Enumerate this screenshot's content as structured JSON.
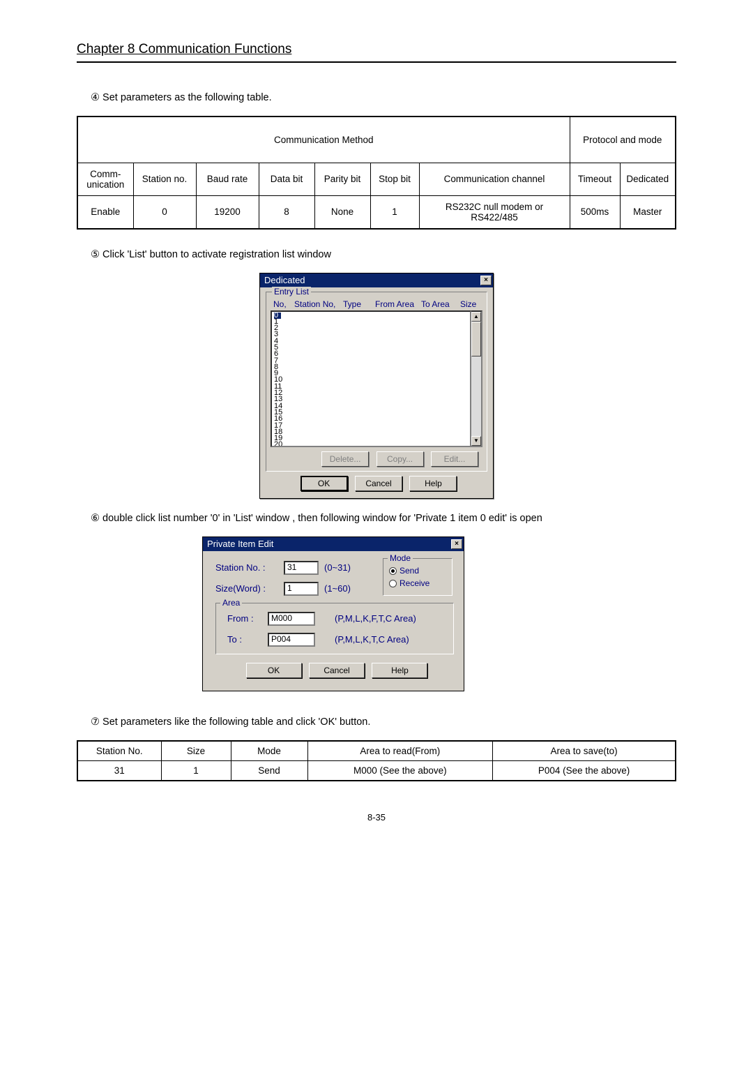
{
  "header": {
    "chapter": "Chapter 8   Communication Functions"
  },
  "step4": {
    "num": "④",
    "text": "Set parameters as the following table."
  },
  "table1": {
    "h_comm_method": "Communication Method",
    "h_protocol": "Protocol and mode",
    "cols": [
      "Comm-unication",
      "Station no.",
      "Baud rate",
      "Data bit",
      "Parity bit",
      "Stop bit",
      "Communication channel",
      "Timeout",
      "Dedicated"
    ],
    "row": [
      "Enable",
      "0",
      "19200",
      "8",
      "None",
      "1",
      "RS232C null modem or RS422/485",
      "500ms",
      "Master"
    ]
  },
  "step5": {
    "num": "⑤",
    "text": "Click 'List' button to activate registration list window"
  },
  "dedicated": {
    "title": "Dedicated",
    "group": "Entry List",
    "hdr": [
      "No,",
      "Station No,",
      "Type",
      "From Area",
      "To Area",
      "Size"
    ],
    "items": [
      "0",
      "1",
      "2",
      "3",
      "4",
      "5",
      "6",
      "7",
      "8",
      "9",
      "10",
      "11",
      "12",
      "13",
      "14",
      "15",
      "16",
      "17",
      "18",
      "19",
      "20"
    ],
    "btn_delete": "Delete...",
    "btn_copy": "Copy...",
    "btn_edit": "Edit...",
    "btn_ok": "OK",
    "btn_cancel": "Cancel",
    "btn_help": "Help"
  },
  "step6": {
    "num": "⑥",
    "text": "double click list number '0' in 'List' window , then following window for 'Private 1 item 0 edit' is open"
  },
  "private": {
    "title": "Private Item Edit",
    "station_lbl": "Station No. :",
    "station_val": "31",
    "station_range": "(0~31)",
    "size_lbl": "Size(Word) :",
    "size_val": "1",
    "size_range": "(1~60)",
    "mode_lbl": "Mode",
    "mode_send": "Send",
    "mode_recv": "Receive",
    "area_lbl": "Area",
    "from_lbl": "From :",
    "from_val": "M000",
    "from_hint": "(P,M,L,K,F,T,C Area)",
    "to_lbl": "To :",
    "to_val": "P004",
    "to_hint": "(P,M,L,K,T,C Area)",
    "btn_ok": "OK",
    "btn_cancel": "Cancel",
    "btn_help": "Help"
  },
  "step7": {
    "num": "⑦",
    "text": "Set parameters like the following table and click 'OK' button."
  },
  "table2": {
    "cols": [
      "Station No.",
      "Size",
      "Mode",
      "Area to read(From)",
      "Area to save(to)"
    ],
    "row": [
      "31",
      "1",
      "Send",
      "M000 (See the above)",
      "P004 (See the above)"
    ]
  },
  "pagenum": "8-35"
}
